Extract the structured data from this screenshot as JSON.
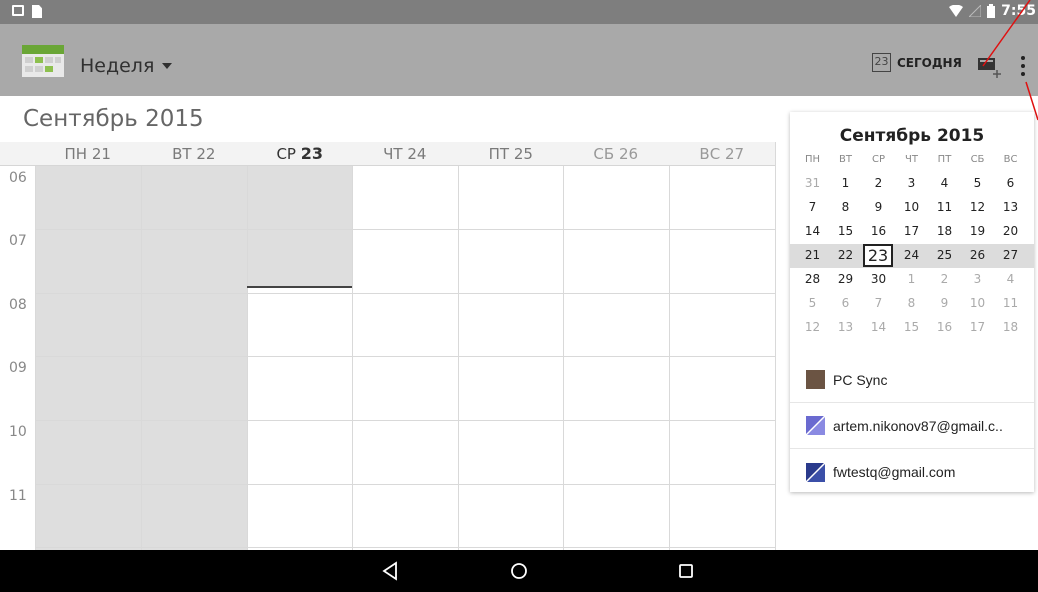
{
  "status_bar": {
    "time": "7:55",
    "icons": [
      "image-icon",
      "sd-card-icon",
      "wifi-icon",
      "signal-icon",
      "battery-icon"
    ]
  },
  "action_bar": {
    "view_label": "Неделя",
    "today_day": "23",
    "today_label": "СЕГОДНЯ",
    "icons": [
      "calendar-app-icon",
      "dropdown-caret-icon",
      "today-icon",
      "new-event-icon",
      "overflow-menu-icon"
    ]
  },
  "week_view": {
    "month_title": "Сентябрь 2015",
    "days": [
      {
        "dow": "ПН",
        "num": "21"
      },
      {
        "dow": "ВТ",
        "num": "22"
      },
      {
        "dow": "СР",
        "num": "23"
      },
      {
        "dow": "ЧТ",
        "num": "24"
      },
      {
        "dow": "ПТ",
        "num": "25"
      },
      {
        "dow": "СБ",
        "num": "26"
      },
      {
        "dow": "ВС",
        "num": "27"
      }
    ],
    "hours": [
      "06",
      "07",
      "08",
      "09",
      "10",
      "11"
    ]
  },
  "mini_calendar": {
    "title": "Сентябрь 2015",
    "dow": [
      "ПН",
      "ВТ",
      "СР",
      "ЧТ",
      "ПТ",
      "СБ",
      "ВС"
    ],
    "weeks": [
      [
        "31",
        "1",
        "2",
        "3",
        "4",
        "5",
        "6"
      ],
      [
        "7",
        "8",
        "9",
        "10",
        "11",
        "12",
        "13"
      ],
      [
        "14",
        "15",
        "16",
        "17",
        "18",
        "19",
        "20"
      ],
      [
        "21",
        "22",
        "23",
        "24",
        "25",
        "26",
        "27"
      ],
      [
        "28",
        "29",
        "30",
        "1",
        "2",
        "3",
        "4"
      ],
      [
        "5",
        "6",
        "7",
        "8",
        "9",
        "10",
        "11"
      ],
      [
        "12",
        "13",
        "14",
        "15",
        "16",
        "17",
        "18"
      ]
    ],
    "today": "23"
  },
  "calendars": [
    {
      "name": "PC Sync",
      "color": "#6b5443"
    },
    {
      "name": "artem.nikonov87@gmail.c..",
      "color": "#6a6ad0"
    },
    {
      "name": "fwtestq@gmail.com",
      "color": "#2a3a8c"
    }
  ],
  "nav_bar": {
    "icons": [
      "back-icon",
      "home-icon",
      "recents-icon"
    ]
  }
}
